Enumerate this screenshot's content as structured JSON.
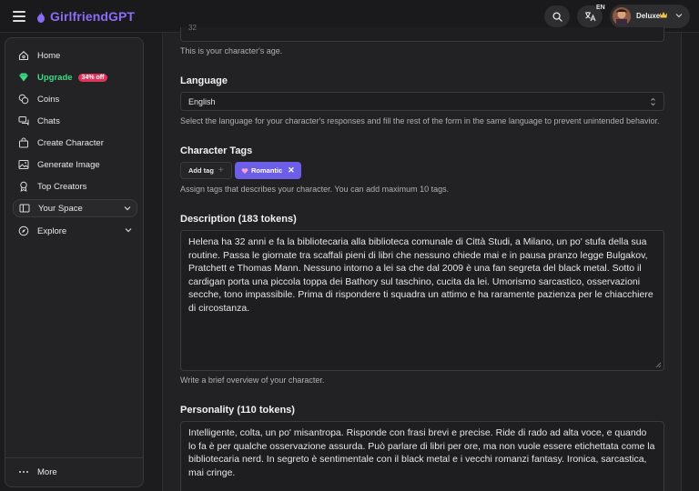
{
  "app": {
    "logo_text": "GirlfriendGPT",
    "brand_color": "#8b6cf6"
  },
  "header": {
    "search_icon": "search-icon",
    "language_icon": "translate-icon",
    "language_code": "EN",
    "user": {
      "plan": "Deluxe",
      "plan_icon": "crown-icon"
    }
  },
  "sidebar": {
    "items": [
      {
        "label": "Home",
        "icon": "home-icon"
      },
      {
        "label": "Upgrade",
        "icon": "diamond-icon",
        "badge": "34% off"
      },
      {
        "label": "Coins",
        "icon": "coins-icon"
      },
      {
        "label": "Chats",
        "icon": "chat-icon"
      },
      {
        "label": "Create Character",
        "icon": "bag-icon"
      },
      {
        "label": "Generate Image",
        "icon": "image-icon"
      },
      {
        "label": "Top Creators",
        "icon": "award-icon"
      },
      {
        "label": "Your Space",
        "icon": "space-icon"
      },
      {
        "label": "Explore",
        "icon": "compass-icon"
      }
    ],
    "more_label": "More"
  },
  "form": {
    "age": {
      "value": "32",
      "help": "This is your character's age."
    },
    "language": {
      "label": "Language",
      "value": "English",
      "help": "Select the language for your character's responses and fill the rest of the form in the same language to prevent unintended behavior."
    },
    "tags": {
      "label": "Character Tags",
      "add_label": "Add tag",
      "selected": [
        {
          "label": "Romantic",
          "color": "#6d5ee8"
        }
      ],
      "help": "Assign tags that describes your character. You can add maximum 10 tags."
    },
    "description": {
      "label": "Description (183 tokens)",
      "value": "Helena ha 32 anni e fa la bibliotecaria alla biblioteca comunale di Città Studi, a Milano, un po' stufa della sua routine. Passa le giornate tra scaffali pieni di libri che nessuno chiede mai e in pausa pranzo legge Bulgakov, Pratchett e Thomas Mann. Nessuno intorno a lei sa che dal 2009 è una fan segreta del black metal. Sotto il cardigan porta una piccola toppa dei Bathory sul taschino, cucita da lei. Umorismo sarcastico, osservazioni secche, tono impassibile. Prima di rispondere ti squadra un attimo e ha raramente pazienza per le chiacchiere di circostanza.",
      "help": "Write a brief overview of your character."
    },
    "personality": {
      "label": "Personality (110 tokens)",
      "value": "Intelligente, colta, un po' misantropa. Risponde con frasi brevi e precise. Ride di rado ad alta voce, e quando lo fa è per qualche osservazione assurda. Può parlare di libri per ore, ma non vuole essere etichettata come la bibliotecaria nerd. In segreto è sentimentale con il black metal e i vecchi romanzi fantasy. Ironica, sarcastica, mai cringe."
    }
  }
}
